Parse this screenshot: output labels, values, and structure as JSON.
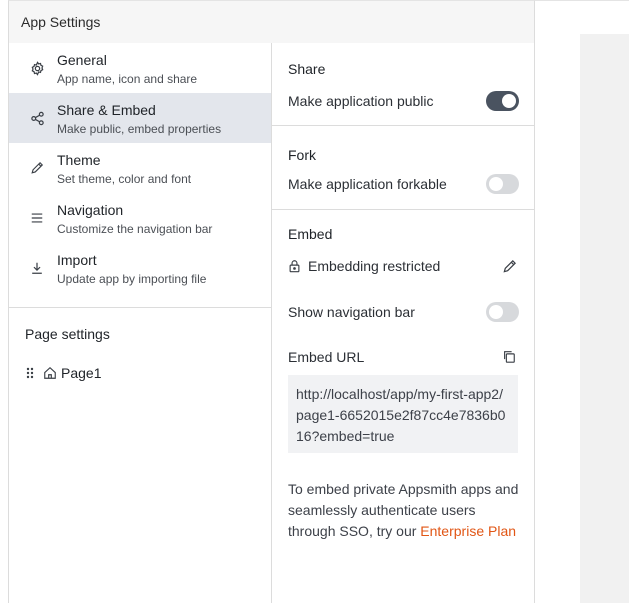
{
  "panel": {
    "title": "App Settings"
  },
  "nav": [
    {
      "title": "General",
      "subtitle": "App name, icon and share",
      "icon": "gear-icon"
    },
    {
      "title": "Share & Embed",
      "subtitle": "Make public, embed properties",
      "icon": "share-icon",
      "active": true
    },
    {
      "title": "Theme",
      "subtitle": "Set theme, color and font",
      "icon": "pencil-icon"
    },
    {
      "title": "Navigation",
      "subtitle": "Customize the navigation bar",
      "icon": "menu-icon"
    },
    {
      "title": "Import",
      "subtitle": "Update app by importing file",
      "icon": "download-icon"
    }
  ],
  "page_settings": {
    "title": "Page settings",
    "pages": [
      "Page1"
    ]
  },
  "share": {
    "title": "Share",
    "public_label": "Make application public",
    "public_on": true
  },
  "fork": {
    "title": "Fork",
    "forkable_label": "Make application forkable",
    "forkable_on": false
  },
  "embed": {
    "title": "Embed",
    "restriction_label": "Embedding restricted",
    "nav_bar_label": "Show navigation bar",
    "nav_bar_on": false,
    "url_label": "Embed URL",
    "url": "http://localhost/app/my-first-app2/page1-6652015e2f87cc4e7836b016?embed=true",
    "note_text": "To embed private Appsmith apps and seamlessly authenticate users through SSO, try our ",
    "note_link": "Enterprise Plan"
  },
  "colors": {
    "accent": "#e15615",
    "toggle_on": "#4a5360",
    "toggle_off": "#d7d9dc",
    "active_bg": "#e3e6ec"
  }
}
